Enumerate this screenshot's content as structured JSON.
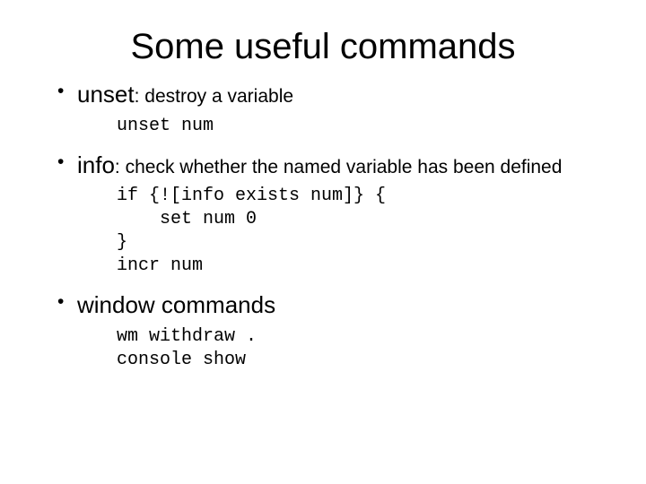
{
  "title": "Some useful commands",
  "items": [
    {
      "cmd": "unset",
      "sep": ": ",
      "desc": "destroy a variable",
      "code": "unset num"
    },
    {
      "cmd": "info",
      "sep": ": ",
      "desc": "check whether the named variable has been defined",
      "code": "if {![info exists num]} {\n    set num 0\n}\nincr num"
    },
    {
      "cmd": "window commands",
      "sep": "",
      "desc": "",
      "code": "wm withdraw .\nconsole show"
    }
  ]
}
